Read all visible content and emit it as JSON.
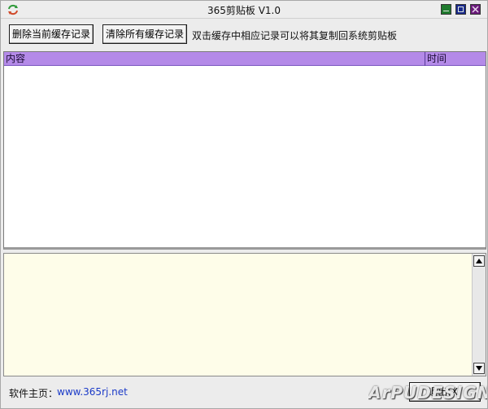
{
  "window": {
    "title": "365剪贴板 V1.0"
  },
  "toolbar": {
    "delete_current_label": "删除当前缓存记录",
    "clear_all_label": "清除所有缓存记录",
    "hint": "双击缓存中相应记录可以将其复制回系统剪贴板"
  },
  "list": {
    "columns": [
      "内容",
      "时间"
    ],
    "rows": []
  },
  "detail": {
    "text": ""
  },
  "footer": {
    "homepage_label": "软件主页：",
    "homepage_link": "www.365rj.net",
    "exit_label": "退出(X)"
  },
  "watermark": {
    "text": "ArPUDESIGN"
  },
  "colors": {
    "header_bg": "#b48ae8",
    "detail_bg": "#fefde9",
    "link": "#1a3ac8",
    "min_button": "#1f7a2e",
    "max_button": "#1a2a8c",
    "close_button": "#6a1a7a"
  },
  "icons": {
    "app": "refresh-arrows-icon",
    "minimize": "minimize-icon",
    "maximize": "maximize-icon",
    "close": "close-icon",
    "scroll_up": "scroll-up-arrow-icon",
    "scroll_down": "scroll-down-arrow-icon"
  }
}
